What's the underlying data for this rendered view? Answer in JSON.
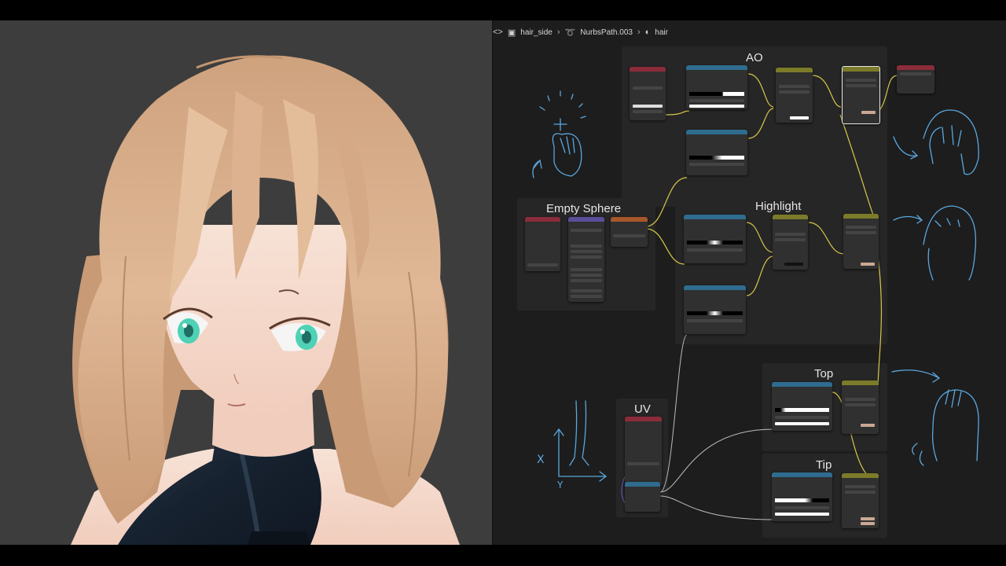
{
  "breadcrumb": {
    "items": [
      {
        "label": "hair_side",
        "icon": "object-icon"
      },
      {
        "label": "NurbsPath.003",
        "icon": "curve-icon"
      },
      {
        "label": "hair",
        "icon": "material-icon"
      }
    ]
  },
  "frames": {
    "ao": "AO",
    "empty_sphere": "Empty Sphere",
    "highlight": "Highlight",
    "top": "Top",
    "tip": "Tip",
    "uv": "UV"
  },
  "doodles": {
    "x_label": "X",
    "y_label": "Y"
  },
  "colors": {
    "hair": "#d9b08e",
    "eyes": "#4fd1b5",
    "bodysuit": "#1c2633",
    "frame_bg": "#262626",
    "node_bg": "#303030",
    "wire_yellow": "#d6c64a",
    "wire_grey": "#bdbdbd",
    "sketch_blue": "#5aa7e0"
  }
}
